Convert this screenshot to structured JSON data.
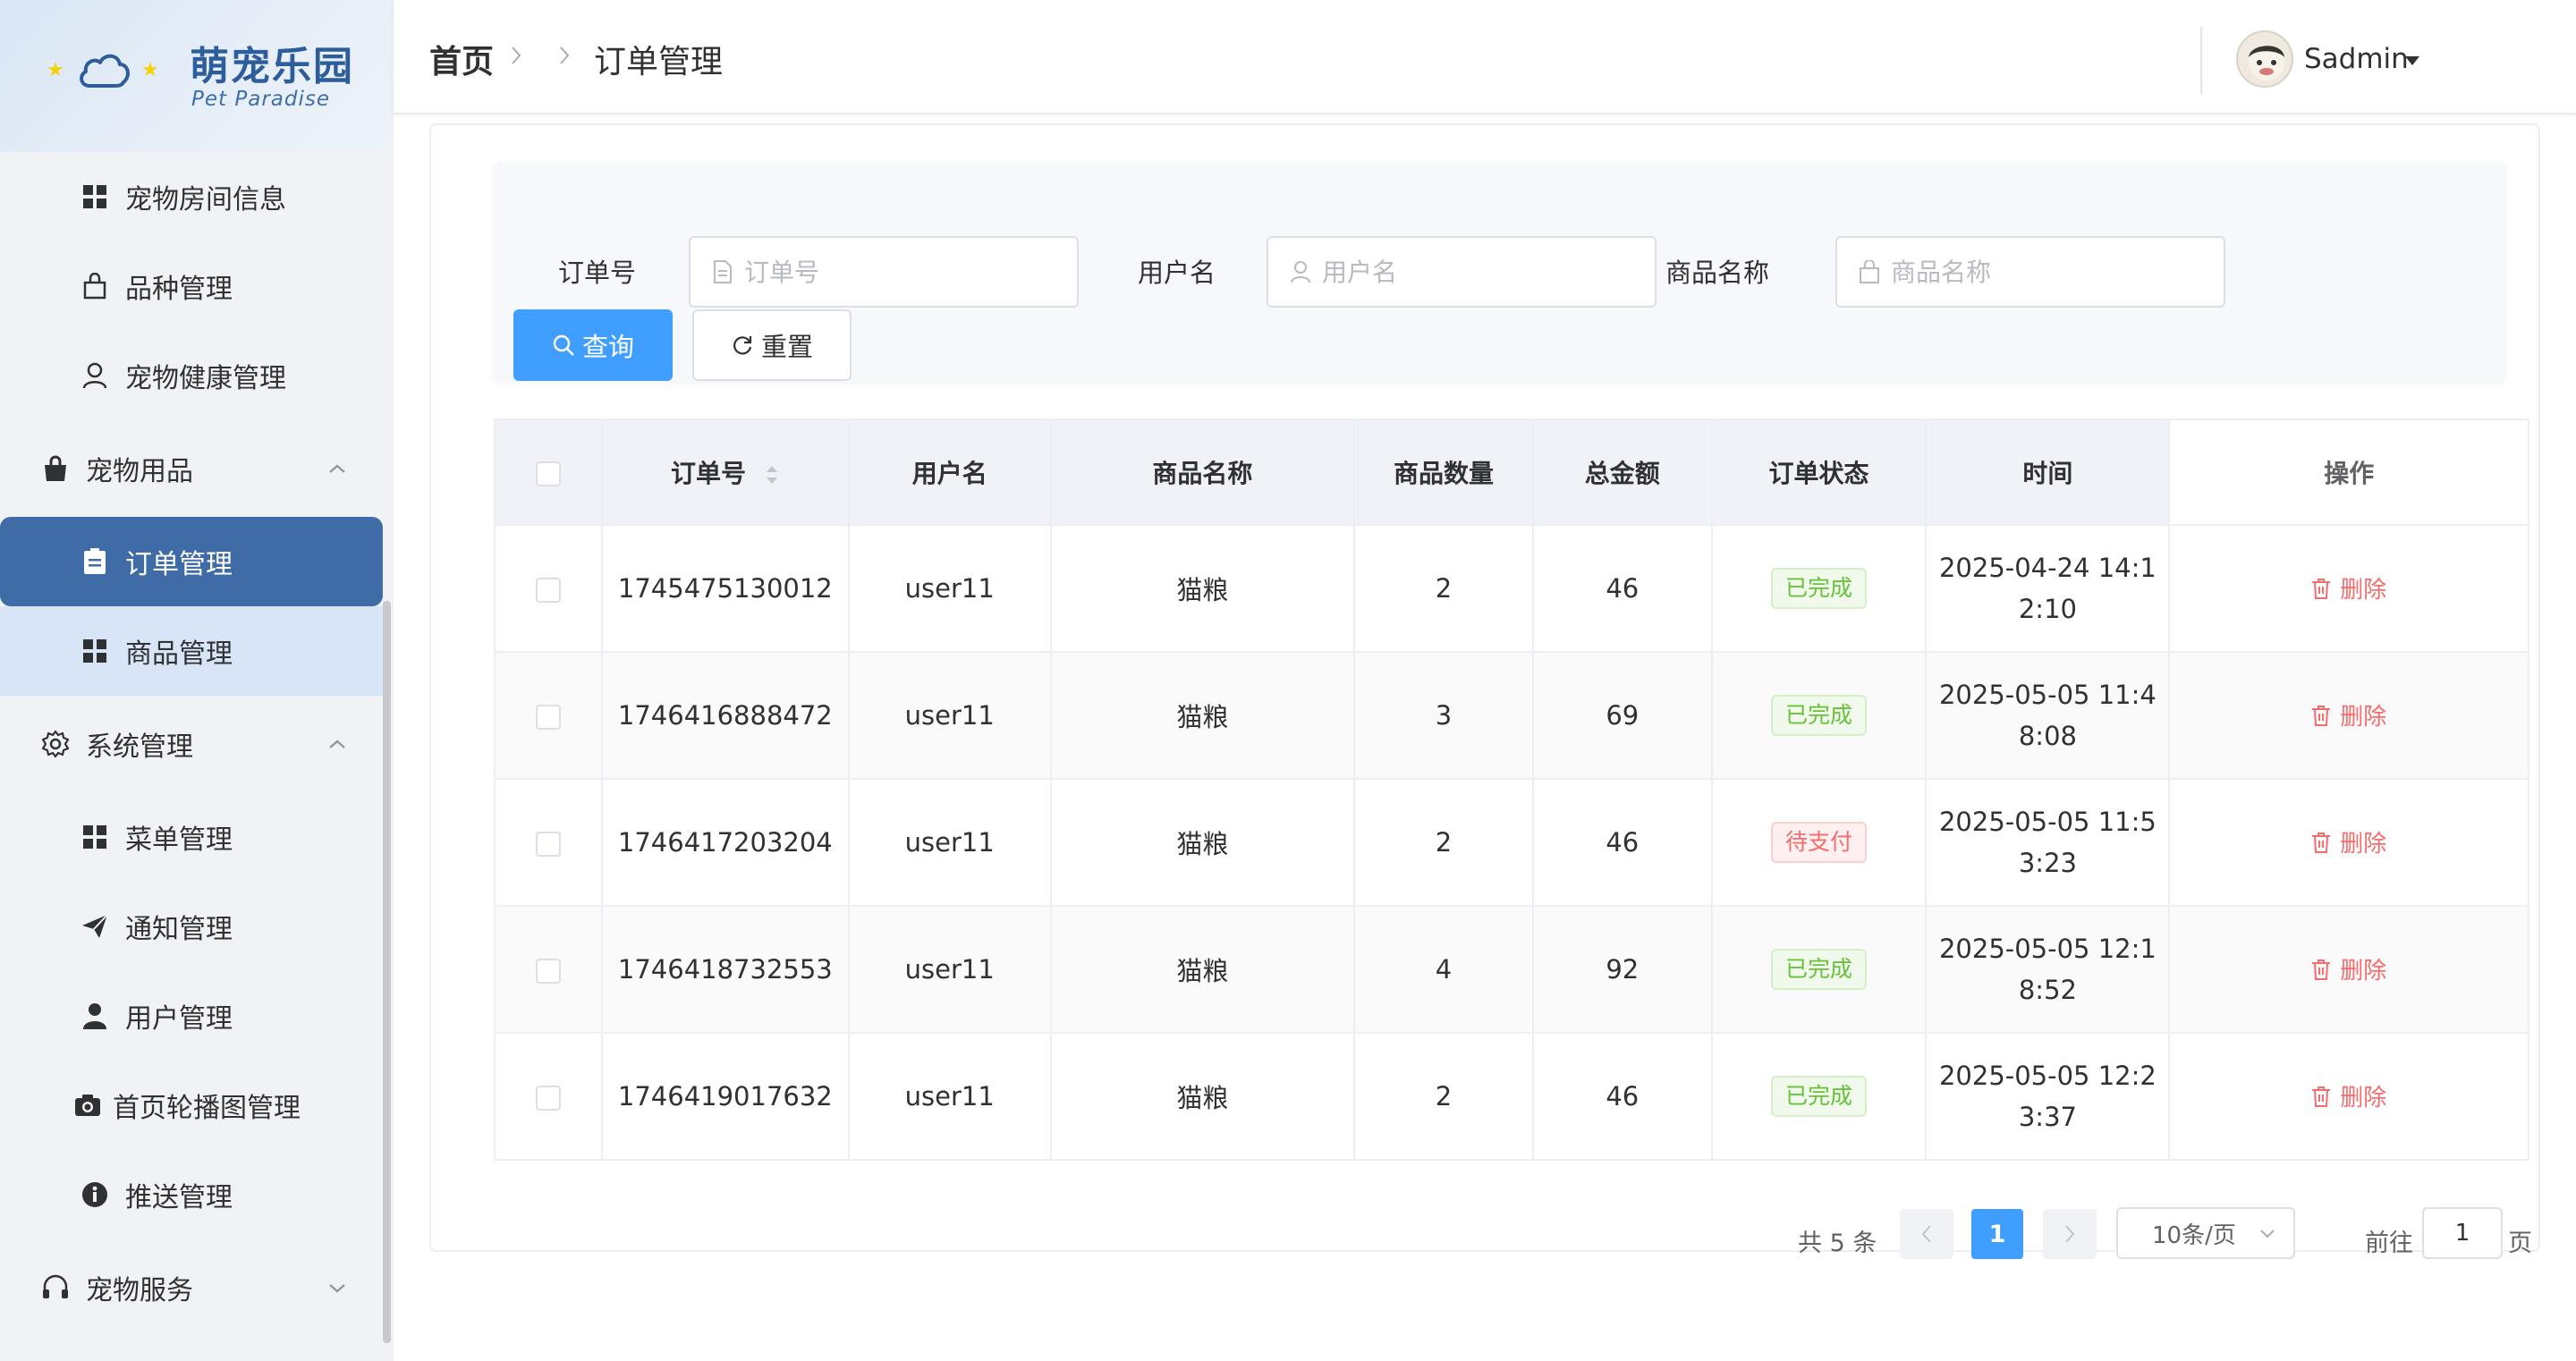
{
  "logo": {
    "title": "萌宠乐园",
    "subtitle": "Pet Paradise"
  },
  "sidebar": {
    "items": [
      {
        "label": "宠物房间信息",
        "icon": "grid-icon"
      },
      {
        "label": "品种管理",
        "icon": "bag-icon"
      },
      {
        "label": "宠物健康管理",
        "icon": "user-outline-icon"
      },
      {
        "label": "宠物用品",
        "icon": "shopping-bag-icon",
        "group": true,
        "expanded": true
      },
      {
        "label": "订单管理",
        "icon": "clipboard-icon",
        "active": true
      },
      {
        "label": "商品管理",
        "icon": "grid-icon"
      },
      {
        "label": "系统管理",
        "icon": "gear-icon",
        "group": true,
        "expanded": true
      },
      {
        "label": "菜单管理",
        "icon": "grid-icon"
      },
      {
        "label": "通知管理",
        "icon": "paper-plane-icon"
      },
      {
        "label": "用户管理",
        "icon": "user-icon"
      },
      {
        "label": "首页轮播图管理",
        "icon": "camera-icon"
      },
      {
        "label": "推送管理",
        "icon": "info-icon"
      },
      {
        "label": "宠物服务",
        "icon": "headset-icon",
        "group": true,
        "expanded": false
      }
    ]
  },
  "header": {
    "breadcrumb": {
      "home": "首页",
      "current": "订单管理"
    },
    "user": {
      "name": "Sadmin"
    }
  },
  "search": {
    "order_no": {
      "label": "订单号",
      "placeholder": "订单号",
      "value": ""
    },
    "username": {
      "label": "用户名",
      "placeholder": "用户名",
      "value": ""
    },
    "product": {
      "label": "商品名称",
      "placeholder": "商品名称",
      "value": ""
    },
    "query_label": "查询",
    "reset_label": "重置"
  },
  "table": {
    "columns": [
      "订单号",
      "用户名",
      "商品名称",
      "商品数量",
      "总金额",
      "订单状态",
      "时间",
      "操作"
    ],
    "delete_label": "删除",
    "rows": [
      {
        "order_no": "1745475130012",
        "user": "user11",
        "product": "猫粮",
        "qty": "2",
        "total": "46",
        "status": "已完成",
        "status_type": "ok",
        "time": "2025-04-24 14:12:10"
      },
      {
        "order_no": "1746416888472",
        "user": "user11",
        "product": "猫粮",
        "qty": "3",
        "total": "69",
        "status": "已完成",
        "status_type": "ok",
        "time": "2025-05-05 11:48:08"
      },
      {
        "order_no": "1746417203204",
        "user": "user11",
        "product": "猫粮",
        "qty": "2",
        "total": "46",
        "status": "待支付",
        "status_type": "wait",
        "time": "2025-05-05 11:53:23"
      },
      {
        "order_no": "1746418732553",
        "user": "user11",
        "product": "猫粮",
        "qty": "4",
        "total": "92",
        "status": "已完成",
        "status_type": "ok",
        "time": "2025-05-05 12:18:52"
      },
      {
        "order_no": "1746419017632",
        "user": "user11",
        "product": "猫粮",
        "qty": "2",
        "total": "46",
        "status": "已完成",
        "status_type": "ok",
        "time": "2025-05-05 12:23:37"
      }
    ]
  },
  "pagination": {
    "total_text": "共 5 条",
    "current_page": "1",
    "page_size": "10条/页",
    "goto_label": "前往",
    "goto_value": "1",
    "page_unit": "页"
  },
  "colors": {
    "primary": "#409eff",
    "sidebar_active": "#3f6ca6",
    "success": "#67c23a",
    "danger": "#f56c6c"
  }
}
